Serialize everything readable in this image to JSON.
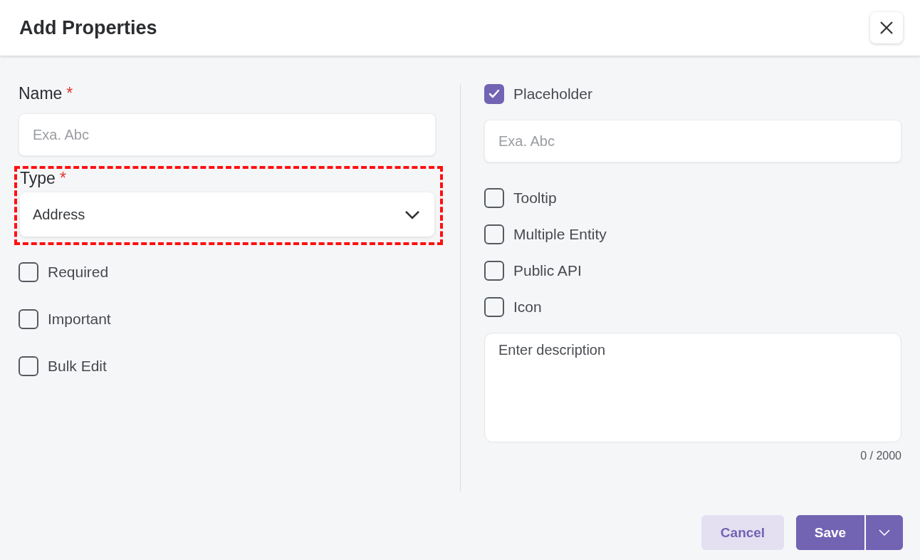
{
  "window": {
    "title": "Add Properties"
  },
  "left": {
    "name_field": {
      "label": "Name",
      "required_mark": "*",
      "placeholder": "Exa. Abc"
    },
    "type_field": {
      "label": "Type",
      "required_mark": "*",
      "value": "Address",
      "highlighted": true
    },
    "checkboxes": [
      {
        "label": "Required",
        "checked": false
      },
      {
        "label": "Important",
        "checked": false
      },
      {
        "label": "Bulk Edit",
        "checked": false
      }
    ]
  },
  "right": {
    "placeholder_option": {
      "label": "Placeholder",
      "checked": true
    },
    "placeholder_field": {
      "placeholder": "Exa. Abc"
    },
    "checkboxes": [
      {
        "label": "Tooltip",
        "checked": false
      },
      {
        "label": "Multiple Entity",
        "checked": false
      },
      {
        "label": "Public API",
        "checked": false
      },
      {
        "label": "Icon",
        "checked": false
      }
    ],
    "description": {
      "placeholder": "Enter description",
      "counter": "0 / 2000"
    }
  },
  "buttons": {
    "cancel": "Cancel",
    "save": "Save"
  }
}
